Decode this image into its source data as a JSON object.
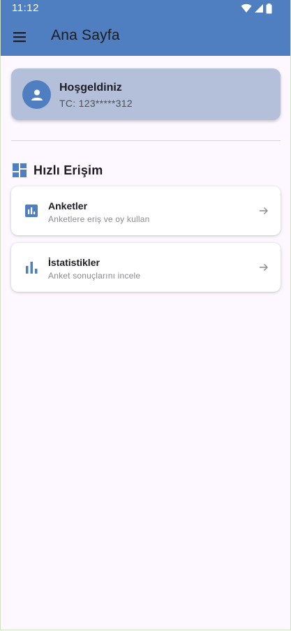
{
  "status_bar": {
    "time": "11:12",
    "icons": [
      "wifi-icon",
      "signal-icon",
      "battery-icon"
    ]
  },
  "app_bar": {
    "menu_icon": "menu-icon",
    "title": "Ana Sayfa"
  },
  "welcome": {
    "title": "Hoşgeldiniz",
    "subtitle": "TC: 123*****312",
    "avatar_icon": "person-icon"
  },
  "quick_access": {
    "icon": "dashboard-icon",
    "title": "Hızlı Erişim",
    "items": [
      {
        "title": "Anketler",
        "subtitle": "Anketlere eriş ve oy kullan",
        "icon": "poll-icon"
      },
      {
        "title": "İstatistikler",
        "subtitle": "Anket sonuçlarını incele",
        "icon": "bar-chart-icon"
      }
    ]
  },
  "colors": {
    "primary": "#4f7fc0",
    "background": "#fdf7ff",
    "welcome_card": "#b4c0d9",
    "text": "#1c1c22",
    "muted": "#8a8a90"
  }
}
